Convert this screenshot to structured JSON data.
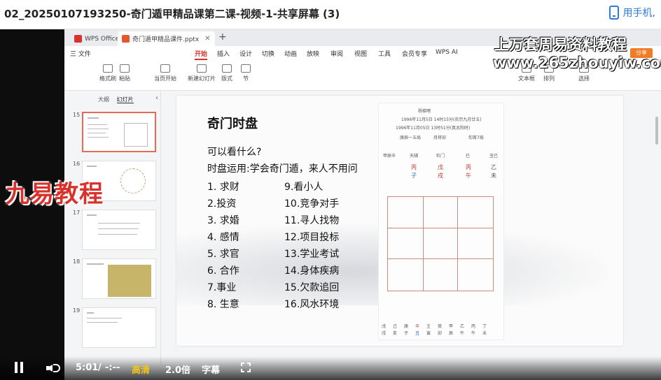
{
  "window": {
    "title": "02_20250107193250-奇门遁甲精品课第二课-视频-1-共享屏幕 (3)",
    "phone_link": "用手机,"
  },
  "wps": {
    "app_tab": "WPS Office",
    "doc_tab": "奇门遁甲精品课件.pptx",
    "menu": [
      "三 文件",
      "开始",
      "插入",
      "设计",
      "切换",
      "动画",
      "放映",
      "审阅",
      "视图",
      "工具",
      "会员专享",
      "WPS AI"
    ],
    "share_label": "分享",
    "ribbon": [
      "格式刷",
      "粘贴",
      "当页开始",
      "新建幻灯片",
      "版式",
      "节",
      "文本框",
      "排列",
      "选择"
    ],
    "thumb_tabs": [
      "大纲",
      "幻灯片"
    ],
    "thumb_numbers": [
      "15",
      "16",
      "17",
      "18",
      "19"
    ]
  },
  "slide": {
    "title": "奇门时盘",
    "question": "可以看什么?",
    "usage": "时盘运用:学会奇门遁，来人不用问",
    "left_items": [
      "1. 求财",
      "2.投资",
      "3. 求婚",
      "4. 感情",
      "5. 求官",
      "6. 合作",
      "7.事业",
      "8. 生意"
    ],
    "right_items": [
      "9.看小人",
      "10.竞争对手",
      "11.寻人找物",
      "12.项目投标",
      "13.学业考试",
      "14.身体疾病",
      "15.欠款追回",
      "16.风水环境"
    ],
    "chart_panel": {
      "header": "杨梯嘿",
      "date1": "1996年11月5日 14时15分(农历九月廿五)",
      "date2": "1996年11月05日 13时51分(真太阳时)",
      "row_a": "庚辰一五局",
      "row_b": "月将卯",
      "row_c": "旬首7局",
      "stems_top": [
        "甲辰辛",
        "天辅",
        "杜门",
        "巳",
        "丑巳"
      ],
      "pillars": [
        "丙",
        "戊",
        "丙",
        "乙"
      ],
      "branches": [
        "子",
        "戌",
        "午",
        "未"
      ],
      "bottom_stems": [
        "戊",
        "己",
        "庚",
        "辛",
        "壬",
        "癸",
        "甲",
        "乙",
        "丙",
        "丁"
      ],
      "bottom_branches": [
        "戌",
        "亥",
        "子",
        "丑",
        "寅",
        "卯",
        "辰",
        "午",
        "午",
        "未"
      ]
    }
  },
  "watermarks": {
    "line1": "上万套周易资料教程",
    "line2": "www.265zhouyiw.com",
    "brand": "九易教程"
  },
  "player": {
    "time": "5:01",
    "separator": "/",
    "duration": "-:--",
    "quality": "高清",
    "speed": "2.0倍",
    "subtitle": "字幕"
  }
}
